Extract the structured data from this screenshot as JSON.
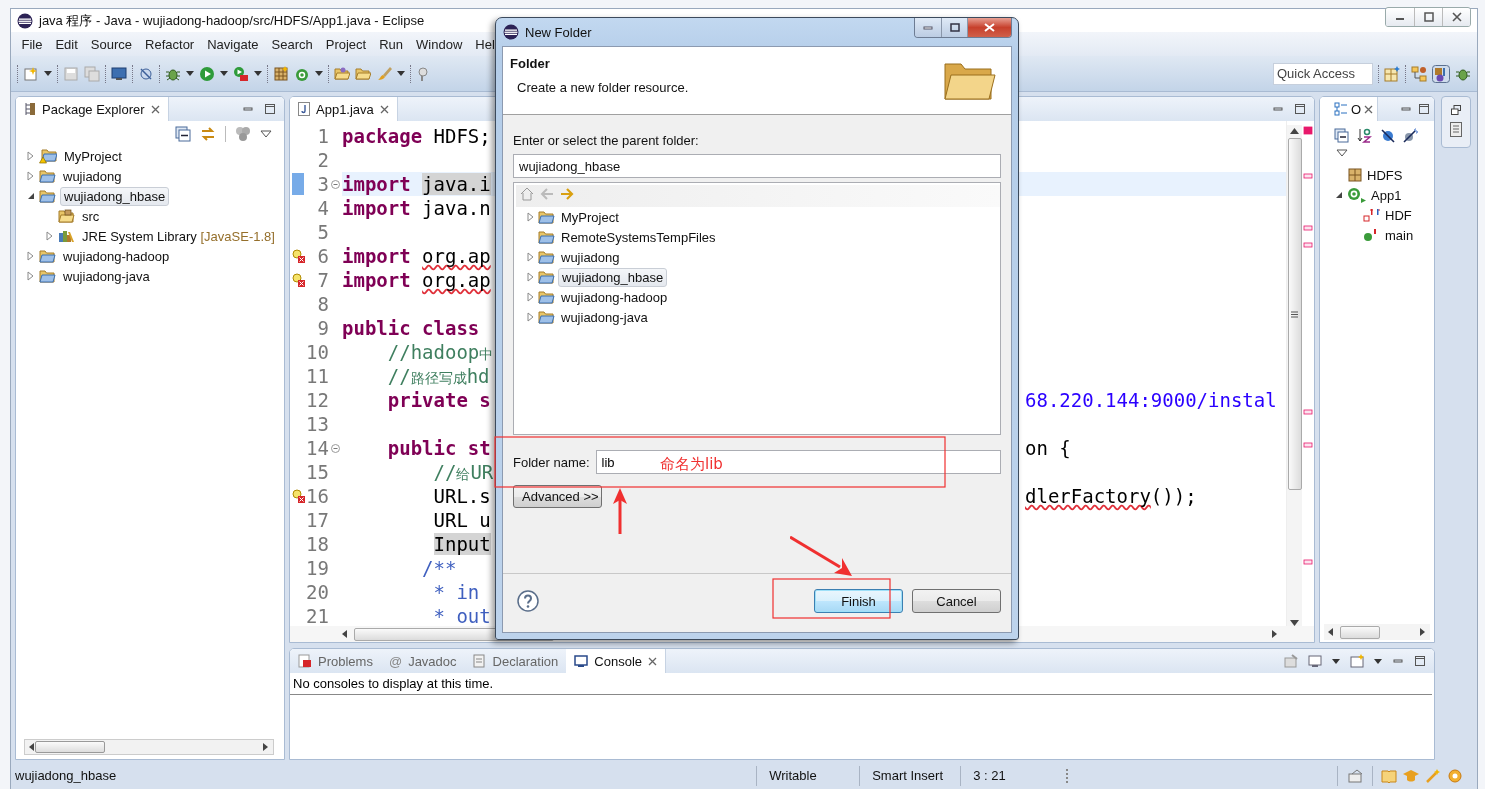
{
  "window": {
    "title": "java 程序 - Java - wujiadong-hadoop/src/HDFS/App1.java - Eclipse"
  },
  "menu": [
    "File",
    "Edit",
    "Source",
    "Refactor",
    "Navigate",
    "Search",
    "Project",
    "Run",
    "Window",
    "Hel"
  ],
  "toolbar": {
    "quick_access": {
      "placeholder": "Quick Access"
    }
  },
  "package_explorer": {
    "title": "Package Explorer",
    "tree": [
      {
        "label": "MyProject",
        "kind": "warning-project",
        "expanded": false,
        "selected": false
      },
      {
        "label": "wujiadong",
        "kind": "project",
        "expanded": false,
        "selected": false
      },
      {
        "label": "wujiadong_hbase",
        "kind": "project",
        "expanded": true,
        "selected": true,
        "children": [
          {
            "label": "src",
            "kind": "source-folder",
            "selected": false
          },
          {
            "label": "JRE System Library",
            "decoration": "[JavaSE-1.8]",
            "kind": "library",
            "expanded": false,
            "selected": false
          }
        ]
      },
      {
        "label": "wujiadong-hadoop",
        "kind": "project",
        "expanded": false,
        "selected": false
      },
      {
        "label": "wujiadong-java",
        "kind": "project",
        "expanded": false,
        "selected": false
      }
    ]
  },
  "editor": {
    "tab": {
      "label": "App1.java"
    },
    "lines": [
      {
        "number": "1",
        "current": false,
        "fold": false,
        "error": false,
        "changed": false,
        "tokens": [
          {
            "kind": "keyword",
            "text": "package"
          },
          {
            "kind": "plain",
            "text": " HDFS;"
          }
        ]
      },
      {
        "number": "2",
        "current": false,
        "fold": false,
        "error": false,
        "changed": false
      },
      {
        "number": "3",
        "current": true,
        "fold": true,
        "error": false,
        "changed": true,
        "tokens": [
          {
            "kind": "keyword",
            "text": "import"
          },
          {
            "kind": "marked",
            "text": " java.i"
          }
        ]
      },
      {
        "number": "4",
        "current": false,
        "fold": false,
        "error": false,
        "changed": false,
        "tokens": [
          {
            "kind": "keyword",
            "text": "import"
          },
          {
            "kind": "plain",
            "text": " java.n"
          }
        ]
      },
      {
        "number": "5",
        "current": false,
        "fold": false,
        "error": false,
        "changed": false
      },
      {
        "number": "6",
        "current": false,
        "fold": false,
        "error": true,
        "changed": false,
        "tokens": [
          {
            "kind": "keyword",
            "text": "import"
          },
          {
            "kind": "error",
            "text": " org.ap"
          }
        ]
      },
      {
        "number": "7",
        "current": false,
        "fold": false,
        "error": true,
        "changed": false,
        "tokens": [
          {
            "kind": "keyword",
            "text": "import"
          },
          {
            "kind": "error",
            "text": " org.ap"
          }
        ]
      },
      {
        "number": "8",
        "current": false,
        "fold": false,
        "error": false,
        "changed": false
      },
      {
        "number": "9",
        "current": false,
        "fold": false,
        "error": false,
        "changed": false,
        "tokens": [
          {
            "kind": "keyword",
            "text": "public class"
          }
        ]
      },
      {
        "number": "10",
        "current": false,
        "fold": false,
        "error": false,
        "changed": false,
        "tokens": [
          {
            "kind": "comment",
            "text": "    //hadoop中"
          }
        ]
      },
      {
        "number": "11",
        "current": false,
        "fold": false,
        "error": false,
        "changed": false,
        "tokens": [
          {
            "kind": "comment",
            "text": "    //路径写成hd"
          }
        ]
      },
      {
        "number": "12",
        "current": false,
        "fold": false,
        "error": false,
        "changed": false,
        "tokens": [
          {
            "kind": "keyword",
            "text": "    private s"
          }
        ],
        "right_tokens": [
          {
            "kind": "string",
            "text": "68.220.144:9000/instal"
          }
        ]
      },
      {
        "number": "13",
        "current": false,
        "fold": false,
        "error": false,
        "changed": false
      },
      {
        "number": "14",
        "current": false,
        "fold": true,
        "error": false,
        "changed": false,
        "tokens": [
          {
            "kind": "keyword",
            "text": "    public st"
          }
        ],
        "right_tokens": [
          {
            "kind": "plain",
            "text": "on {"
          }
        ]
      },
      {
        "number": "15",
        "current": false,
        "fold": false,
        "error": false,
        "changed": false,
        "tokens": [
          {
            "kind": "comment",
            "text": "        //给UR"
          }
        ]
      },
      {
        "number": "16",
        "current": false,
        "fold": false,
        "error": true,
        "changed": false,
        "tokens": [
          {
            "kind": "plain",
            "text": "        URL.s"
          }
        ],
        "right_tokens": [
          {
            "kind": "error",
            "text": "dlerFactory"
          },
          {
            "kind": "plain",
            "text": "());"
          }
        ]
      },
      {
        "number": "17",
        "current": false,
        "fold": false,
        "error": false,
        "changed": false,
        "tokens": [
          {
            "kind": "plain",
            "text": "        URL u"
          }
        ]
      },
      {
        "number": "18",
        "current": false,
        "fold": false,
        "error": false,
        "changed": false,
        "tokens": [
          {
            "kind": "marked",
            "text": "        Input"
          }
        ]
      },
      {
        "number": "19",
        "current": false,
        "fold": false,
        "error": false,
        "changed": false,
        "tokens": [
          {
            "kind": "javadoc",
            "text": "       /**"
          }
        ]
      },
      {
        "number": "20",
        "current": false,
        "fold": false,
        "error": false,
        "changed": false,
        "tokens": [
          {
            "kind": "javadoc",
            "text": "        * in"
          }
        ]
      },
      {
        "number": "21",
        "current": false,
        "fold": false,
        "error": false,
        "changed": false,
        "tokens": [
          {
            "kind": "javadoc",
            "text": "        * out"
          }
        ]
      }
    ]
  },
  "outline": {
    "title": "O",
    "tree": [
      {
        "label": "HDFS",
        "kind": "package"
      },
      {
        "label": "App1",
        "kind": "class",
        "expanded": true,
        "children": [
          {
            "label": "HDF",
            "kind": "field"
          },
          {
            "label": "main",
            "kind": "method"
          }
        ]
      }
    ]
  },
  "console": {
    "tabs": [
      {
        "label": "Problems",
        "kind": "problems",
        "selected": false
      },
      {
        "label": "Javadoc",
        "kind": "glyph",
        "glyph": "@",
        "selected": false
      },
      {
        "label": "Declaration",
        "kind": "declaration",
        "selected": false
      },
      {
        "label": "Console",
        "kind": "console",
        "selected": true
      }
    ],
    "message": "No consoles to display at this time."
  },
  "status_bar": {
    "selection": "wujiadong_hbase",
    "mode": "Writable",
    "insert": "Smart Insert",
    "position": "3 : 21"
  },
  "dialog": {
    "title": "New Folder",
    "header": {
      "title": "Folder",
      "description": "Create a new folder resource."
    },
    "parent_label": "Enter or select the parent folder:",
    "parent_value": "wujiadong_hbase",
    "folders": [
      {
        "label": "MyProject",
        "expanded": false,
        "selected": false
      },
      {
        "label": "RemoteSystemsTempFiles",
        "selected": false
      },
      {
        "label": "wujiadong",
        "expanded": false,
        "selected": false
      },
      {
        "label": "wujiadong_hbase",
        "expanded": false,
        "selected": true
      },
      {
        "label": "wujiadong-hadoop",
        "expanded": false,
        "selected": false
      },
      {
        "label": "wujiadong-java",
        "expanded": false,
        "selected": false
      }
    ],
    "name_label": "Folder name:",
    "name_value": "lib",
    "advanced": {
      "label": "Advanced >>"
    },
    "buttons": [
      {
        "label": "Finish",
        "default": true
      },
      {
        "label": "Cancel",
        "default": false
      }
    ]
  },
  "annotation": {
    "note": "命名为lib"
  }
}
